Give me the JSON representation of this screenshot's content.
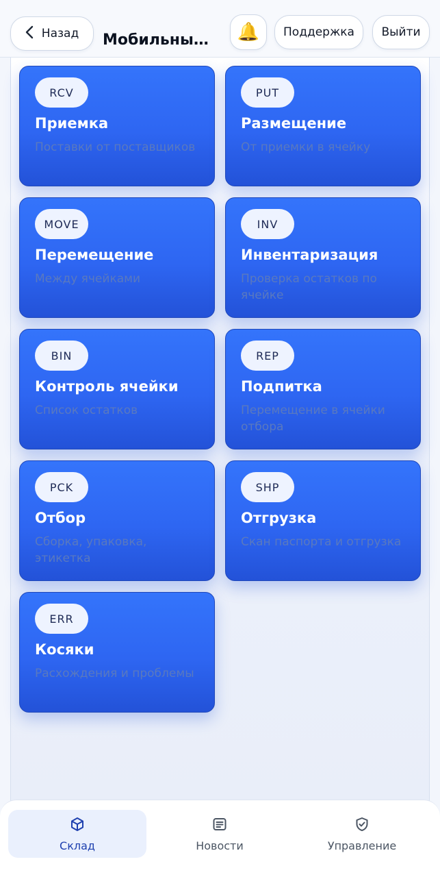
{
  "header": {
    "back_label": "Назад",
    "title": "Мобильный ...",
    "bell_icon": "bell-icon",
    "support_label": "Поддержка",
    "logout_label": "Выйти"
  },
  "tiles": [
    {
      "code": "RCV",
      "title": "Приемка",
      "desc": "Поставки от поставщиков"
    },
    {
      "code": "PUT",
      "title": "Размещение",
      "desc": "От приемки в ячейку"
    },
    {
      "code": "MOVE",
      "title": "Перемещение",
      "desc": "Между ячейками"
    },
    {
      "code": "INV",
      "title": "Инвентаризация",
      "desc": "Проверка остатков по ячейке"
    },
    {
      "code": "BIN",
      "title": "Контроль ячейки",
      "desc": "Список остатков"
    },
    {
      "code": "REP",
      "title": "Подпитка",
      "desc": "Перемещение в ячейки отбора"
    },
    {
      "code": "PCK",
      "title": "Отбор",
      "desc": "Сборка, упаковка, этикетка"
    },
    {
      "code": "SHP",
      "title": "Отгрузка",
      "desc": "Скан паспорта и отгрузка"
    },
    {
      "code": "ERR",
      "title": "Косяки",
      "desc": "Расхождения и проблемы"
    }
  ],
  "nav": {
    "items": [
      {
        "label": "Склад",
        "icon": "box-icon",
        "active": true
      },
      {
        "label": "Новости",
        "icon": "news-icon",
        "active": false
      },
      {
        "label": "Управление",
        "icon": "shield-check-icon",
        "active": false
      }
    ]
  },
  "colors": {
    "tile_blue": "#2e66f2",
    "accent": "#1e40af"
  }
}
